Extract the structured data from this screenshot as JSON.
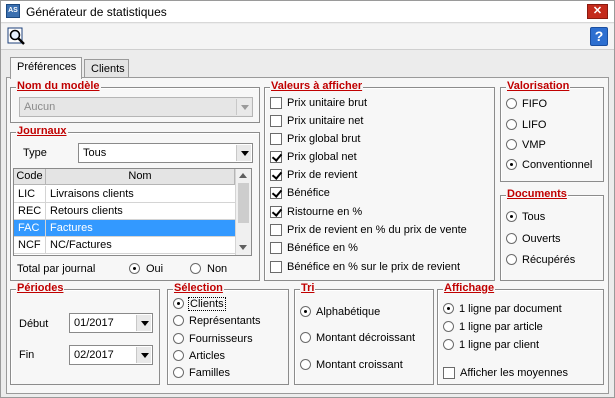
{
  "window": {
    "title": "Générateur de statistiques",
    "app_icon": "app-icon",
    "close_label": "✕"
  },
  "toolbar": {
    "search_icon": "magnifier-icon",
    "help_label": "?"
  },
  "tabs": [
    {
      "label": "Préférences",
      "active": true
    },
    {
      "label": "Clients",
      "active": false
    }
  ],
  "nom_modele": {
    "title": "Nom du modèle",
    "value": "Aucun"
  },
  "journaux": {
    "title": "Journaux",
    "type_label": "Type",
    "type_value": "Tous",
    "columns": [
      "Code",
      "Nom"
    ],
    "rows": [
      {
        "code": "LIC",
        "nom": "Livraisons clients",
        "selected": false
      },
      {
        "code": "REC",
        "nom": "Retours clients",
        "selected": false
      },
      {
        "code": "FAC",
        "nom": "Factures",
        "selected": true
      },
      {
        "code": "NCF",
        "nom": "NC/Factures",
        "selected": false
      }
    ],
    "total_label": "Total par journal",
    "oui_label": "Oui",
    "non_label": "Non",
    "total_value": "Oui"
  },
  "valeurs": {
    "title": "Valeurs à afficher",
    "items": [
      {
        "label": "Prix unitaire brut",
        "checked": false
      },
      {
        "label": "Prix unitaire net",
        "checked": false
      },
      {
        "label": "Prix global brut",
        "checked": false
      },
      {
        "label": "Prix global net",
        "checked": true
      },
      {
        "label": "Prix de revient",
        "checked": true
      },
      {
        "label": "Bénéfice",
        "checked": true
      },
      {
        "label": "Ristourne en %",
        "checked": true
      },
      {
        "label": "Prix de revient en % du prix de vente",
        "checked": false
      },
      {
        "label": "Bénéfice en %",
        "checked": false
      },
      {
        "label": "Bénéfice en % sur le prix de revient",
        "checked": false
      }
    ]
  },
  "valorisation": {
    "title": "Valorisation",
    "options": [
      {
        "label": "FIFO",
        "selected": false
      },
      {
        "label": "LIFO",
        "selected": false
      },
      {
        "label": "VMP",
        "selected": false
      },
      {
        "label": "Conventionnel",
        "selected": true
      }
    ]
  },
  "documents": {
    "title": "Documents",
    "options": [
      {
        "label": "Tous",
        "selected": true
      },
      {
        "label": "Ouverts",
        "selected": false
      },
      {
        "label": "Récupérés",
        "selected": false
      }
    ]
  },
  "periodes": {
    "title": "Périodes",
    "debut_label": "Début",
    "debut_value": "01/2017",
    "fin_label": "Fin",
    "fin_value": "02/2017"
  },
  "selection": {
    "title": "Sélection",
    "options": [
      {
        "label": "Clients",
        "selected": true
      },
      {
        "label": "Représentants",
        "selected": false
      },
      {
        "label": "Fournisseurs",
        "selected": false
      },
      {
        "label": "Articles",
        "selected": false
      },
      {
        "label": "Familles",
        "selected": false
      }
    ]
  },
  "tri": {
    "title": "Tri",
    "options": [
      {
        "label": "Alphabétique",
        "selected": true
      },
      {
        "label": "Montant décroissant",
        "selected": false
      },
      {
        "label": "Montant croissant",
        "selected": false
      }
    ]
  },
  "affichage": {
    "title": "Affichage",
    "options": [
      {
        "label": "1 ligne par document",
        "selected": true
      },
      {
        "label": "1 ligne par article",
        "selected": false
      },
      {
        "label": "1 ligne par client",
        "selected": false
      }
    ],
    "moyennes_label": "Afficher les moyennes",
    "moyennes_checked": false
  },
  "colors": {
    "group_title": "#c00000",
    "selection": "#3399ff",
    "close": "#c42b1c",
    "help": "#2d6fd0"
  }
}
